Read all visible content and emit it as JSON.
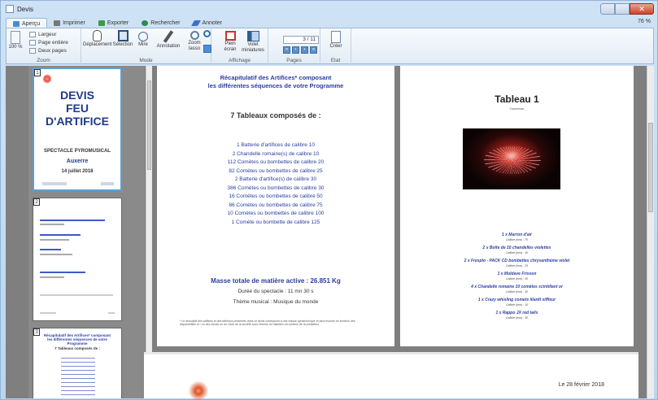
{
  "window": {
    "title": "Devis"
  },
  "tabs": [
    "Aperçu",
    "Imprimer",
    "Exporter",
    "Rechercher",
    "Annoter"
  ],
  "zoom_level": "76 %",
  "ribbon": {
    "zoom": {
      "label": "Zoom",
      "percent": "100 %",
      "options": [
        "Largeur",
        "Page entière",
        "Deux pages"
      ]
    },
    "mode": {
      "label": "Mode",
      "buttons": [
        "Déplacement",
        "Sélection",
        "Mire",
        "Annotation",
        "Zoom lasso"
      ]
    },
    "affichage": {
      "label": "Affichage",
      "buttons": [
        "Plein écran",
        "Volet miniatures"
      ]
    },
    "pages": {
      "label": "Pages",
      "current": "3 / 11"
    },
    "etat": {
      "label": "Etat",
      "button": "Créer"
    }
  },
  "thumbnails": {
    "numbers": [
      "1",
      "2",
      "3"
    ],
    "cover": {
      "title_lines": [
        "DEVIS",
        "FEU",
        "D'ARTIFICE"
      ],
      "subtitle": "SPECTACLE PYROMUSICAL",
      "city": "Auxerre",
      "date": "14 juillet 2018"
    },
    "page3": {
      "title": "Récapitulatif des Artifices* composant les différentes séquences de votre Programme",
      "subtitle": "7 Tableaux composés de :"
    }
  },
  "page_summary": {
    "title_line1": "Récapitulatif des Artifices* composant",
    "title_line2": "les différentes séquences de votre Programme",
    "subtitle": "7 Tableaux composés de :",
    "items": [
      "1 Batterie d'artifices de calibre 10",
      "2 Chandelle romaine(s) de calibre 10",
      "112 Comètes ou bombettes de calibre 20",
      "82 Comètes ou bombettes de calibre 25",
      "2 Batterie d'artifice(s) de calibre 30",
      "386 Comètes ou bombettes de calibre 30",
      "16 Comètes ou bombettes de calibre 50",
      "86 Comètes ou bombettes de calibre 75",
      "10 Comètes ou bombettes de calibre 100",
      "1 Comète ou bombette de calibre 125"
    ],
    "mass": "Masse totale de matière active : 26.851 Kg",
    "duration": "Durée du spectacle : 11 mn 30 s",
    "theme": "Thème musical : Musique du monde",
    "footnote": "* Le descriptif des artifices et des tableaux présentés dans ce devis correspond à une masse pyrotechnique et peut évoluer en fonction des disponibilités et / ou des stocks ou du choix de la société sous réserve du maintien du contenu de la prestation."
  },
  "page_tableau": {
    "title": "Tableau 1",
    "subtitle": "Ouverture",
    "items": [
      {
        "name": "1 x Marron d'air",
        "detail": "Calibre (mm) : 75"
      },
      {
        "name": "2 x Boîte de 10 chandelles violettes",
        "detail": "Calibre (mm) : 10"
      },
      {
        "name": "2 x Fresplo - PACK CD bombettes chrysanthème violet",
        "detail": "Calibre (mm) : 25"
      },
      {
        "name": "1 x Moldave Frisson",
        "detail": "Calibre (mm) : 30"
      },
      {
        "name": "4 x Chandelle romaine 10 comètes scintillant or",
        "detail": "Calibre (mm) : 30"
      },
      {
        "name": "1 x Crazy whisling comets lilardt siffleur",
        "detail": "Calibre (mm) : 10"
      },
      {
        "name": "1 x Rappo JX red tails",
        "detail": "Calibre (mm) : 30"
      }
    ]
  },
  "page_next": {
    "date": "Le 28 février 2018"
  }
}
